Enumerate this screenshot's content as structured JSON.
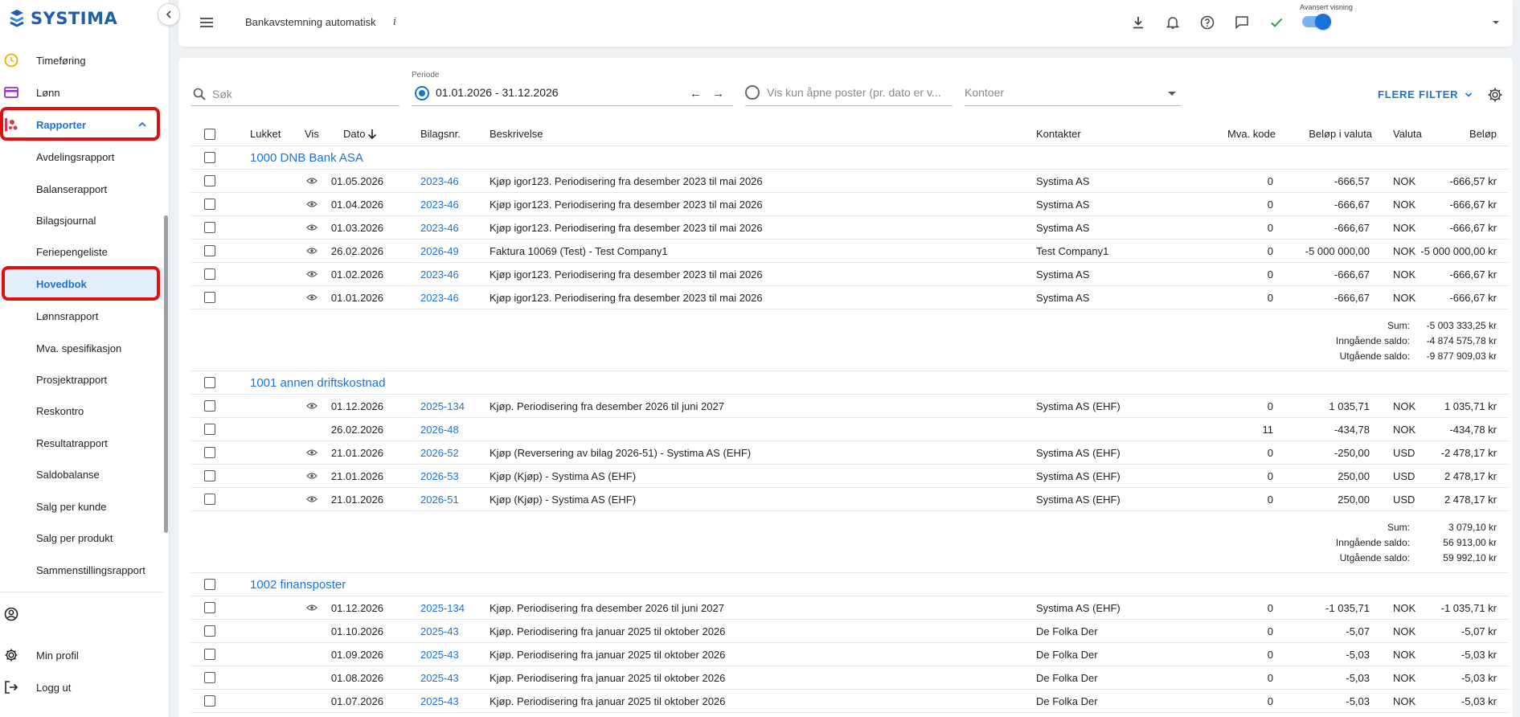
{
  "brand": {
    "name": "SYSTIMA",
    "color": "#1f5fa8"
  },
  "sidebar": {
    "items": [
      {
        "label": "Timeføring",
        "icon": "clock-icon"
      },
      {
        "label": "Lønn",
        "icon": "card-icon"
      },
      {
        "label": "Rapporter",
        "icon": "reports-icon"
      },
      {
        "label": "Avdelingsrapport"
      },
      {
        "label": "Balanserapport"
      },
      {
        "label": "Bilagsjournal"
      },
      {
        "label": "Feriepengeliste"
      },
      {
        "label": "Hovedbok"
      },
      {
        "label": "Lønnsrapport"
      },
      {
        "label": "Mva. spesifikasjon"
      },
      {
        "label": "Prosjektrapport"
      },
      {
        "label": "Reskontro"
      },
      {
        "label": "Resultatrapport"
      },
      {
        "label": "Saldobalanse"
      },
      {
        "label": "Salg per kunde"
      },
      {
        "label": "Salg per produkt"
      },
      {
        "label": "Sammenstillingsrapport"
      }
    ],
    "bottom": [
      {
        "label": "",
        "icon": "account-circle-icon"
      },
      {
        "label": "Min profil",
        "icon": "gear-icon"
      },
      {
        "label": "Logg ut",
        "icon": "logout-icon"
      }
    ]
  },
  "header": {
    "title": "Bankavstemning automatisk",
    "info": "i",
    "advanced_label": "Avansert visning"
  },
  "filters": {
    "search_placeholder": "Søk",
    "periode_label": "Periode",
    "periode_value": "01.01.2026 - 31.12.2026",
    "open_posts_label": "Vis kun åpne poster (pr. dato er v...",
    "kontoer_label": "Kontoer",
    "more_filters": "FLERE FILTER"
  },
  "table": {
    "columns": {
      "lukket": "Lukket",
      "vis": "Vis",
      "dato": "Dato",
      "bilagsnr": "Bilagsnr.",
      "beskrivelse": "Beskrivelse",
      "kontakter": "Kontakter",
      "mva": "Mva. kode",
      "belop_valuta": "Beløp i valuta",
      "valuta": "Valuta",
      "belop": "Beløp"
    },
    "sum_labels": {
      "sum": "Sum:",
      "inngaende": "Inngående saldo:",
      "utgaende": "Utgående saldo:"
    },
    "groups": [
      {
        "title": "1000 DNB Bank ASA",
        "rows": [
          {
            "vis": true,
            "dato": "01.05.2026",
            "bilag": "2023-46",
            "beskrivelse": "Kjøp igor123. Periodisering fra desember 2023 til mai 2026",
            "kontakt": "Systima AS",
            "mva": "0",
            "belop_valuta": "-666,57",
            "valuta": "NOK",
            "belop": "-666,57 kr"
          },
          {
            "vis": true,
            "dato": "01.04.2026",
            "bilag": "2023-46",
            "beskrivelse": "Kjøp igor123. Periodisering fra desember 2023 til mai 2026",
            "kontakt": "Systima AS",
            "mva": "0",
            "belop_valuta": "-666,67",
            "valuta": "NOK",
            "belop": "-666,67 kr"
          },
          {
            "vis": true,
            "dato": "01.03.2026",
            "bilag": "2023-46",
            "beskrivelse": "Kjøp igor123. Periodisering fra desember 2023 til mai 2026",
            "kontakt": "Systima AS",
            "mva": "0",
            "belop_valuta": "-666,67",
            "valuta": "NOK",
            "belop": "-666,67 kr"
          },
          {
            "vis": true,
            "dato": "26.02.2026",
            "bilag": "2026-49",
            "beskrivelse": "Faktura 10069 (Test) - Test Company1",
            "kontakt": "Test Company1",
            "mva": "0",
            "belop_valuta": "-5 000 000,00",
            "valuta": "NOK",
            "belop": "-5 000 000,00 kr"
          },
          {
            "vis": true,
            "dato": "01.02.2026",
            "bilag": "2023-46",
            "beskrivelse": "Kjøp igor123. Periodisering fra desember 2023 til mai 2026",
            "kontakt": "Systima AS",
            "mva": "0",
            "belop_valuta": "-666,67",
            "valuta": "NOK",
            "belop": "-666,67 kr"
          },
          {
            "vis": true,
            "dato": "01.01.2026",
            "bilag": "2023-46",
            "beskrivelse": "Kjøp igor123. Periodisering fra desember 2023 til mai 2026",
            "kontakt": "Systima AS",
            "mva": "0",
            "belop_valuta": "-666,67",
            "valuta": "NOK",
            "belop": "-666,67 kr"
          }
        ],
        "sum": "-5 003 333,25 kr",
        "inngaende": "-4 874 575,78 kr",
        "utgaende": "-9 877 909,03 kr"
      },
      {
        "title": "1001 annen driftskostnad",
        "rows": [
          {
            "vis": true,
            "dato": "01.12.2026",
            "bilag": "2025-134",
            "beskrivelse": "Kjøp. Periodisering fra desember 2026 til juni 2027",
            "kontakt": "Systima AS (EHF)",
            "mva": "0",
            "belop_valuta": "1 035,71",
            "valuta": "NOK",
            "belop": "1 035,71 kr"
          },
          {
            "vis": false,
            "dato": "26.02.2026",
            "bilag": "2026-48",
            "beskrivelse": "",
            "kontakt": "",
            "mva": "11",
            "belop_valuta": "-434,78",
            "valuta": "NOK",
            "belop": "-434,78 kr"
          },
          {
            "vis": true,
            "dato": "21.01.2026",
            "bilag": "2026-52",
            "beskrivelse": "Kjøp (Reversering av bilag 2026-51) - Systima AS (EHF)",
            "kontakt": "Systima AS (EHF)",
            "mva": "0",
            "belop_valuta": "-250,00",
            "valuta": "USD",
            "belop": "-2 478,17 kr"
          },
          {
            "vis": true,
            "dato": "21.01.2026",
            "bilag": "2026-53",
            "beskrivelse": "Kjøp (Kjøp) - Systima AS (EHF)",
            "kontakt": "Systima AS (EHF)",
            "mva": "0",
            "belop_valuta": "250,00",
            "valuta": "USD",
            "belop": "2 478,17 kr"
          },
          {
            "vis": true,
            "dato": "21.01.2026",
            "bilag": "2026-51",
            "beskrivelse": "Kjøp (Kjøp) - Systima AS (EHF)",
            "kontakt": "Systima AS (EHF)",
            "mva": "0",
            "belop_valuta": "250,00",
            "valuta": "USD",
            "belop": "2 478,17 kr"
          }
        ],
        "sum": "3 079,10 kr",
        "inngaende": "56 913,00 kr",
        "utgaende": "59 992,10 kr"
      },
      {
        "title": "1002 finansposter",
        "rows": [
          {
            "vis": true,
            "dato": "01.12.2026",
            "bilag": "2025-134",
            "beskrivelse": "Kjøp. Periodisering fra desember 2026 til juni 2027",
            "kontakt": "Systima AS (EHF)",
            "mva": "0",
            "belop_valuta": "-1 035,71",
            "valuta": "NOK",
            "belop": "-1 035,71 kr"
          },
          {
            "vis": false,
            "dato": "01.10.2026",
            "bilag": "2025-43",
            "beskrivelse": "Kjøp. Periodisering fra januar 2025 til oktober 2026",
            "kontakt": "De Folka Der",
            "mva": "0",
            "belop_valuta": "-5,07",
            "valuta": "NOK",
            "belop": "-5,07 kr"
          },
          {
            "vis": false,
            "dato": "01.09.2026",
            "bilag": "2025-43",
            "beskrivelse": "Kjøp. Periodisering fra januar 2025 til oktober 2026",
            "kontakt": "De Folka Der",
            "mva": "0",
            "belop_valuta": "-5,03",
            "valuta": "NOK",
            "belop": "-5,03 kr"
          },
          {
            "vis": false,
            "dato": "01.08.2026",
            "bilag": "2025-43",
            "beskrivelse": "Kjøp. Periodisering fra januar 2025 til oktober 2026",
            "kontakt": "De Folka Der",
            "mva": "0",
            "belop_valuta": "-5,03",
            "valuta": "NOK",
            "belop": "-5,03 kr"
          },
          {
            "vis": false,
            "dato": "01.07.2026",
            "bilag": "2025-43",
            "beskrivelse": "Kjøp. Periodisering fra januar 2025 til oktober 2026",
            "kontakt": "De Folka Der",
            "mva": "0",
            "belop_valuta": "-5,03",
            "valuta": "NOK",
            "belop": "-5,03 kr"
          }
        ]
      }
    ]
  },
  "colors": {
    "accent": "#1a73d9",
    "highlight": "#e01010",
    "check": "#2e9e4a"
  }
}
